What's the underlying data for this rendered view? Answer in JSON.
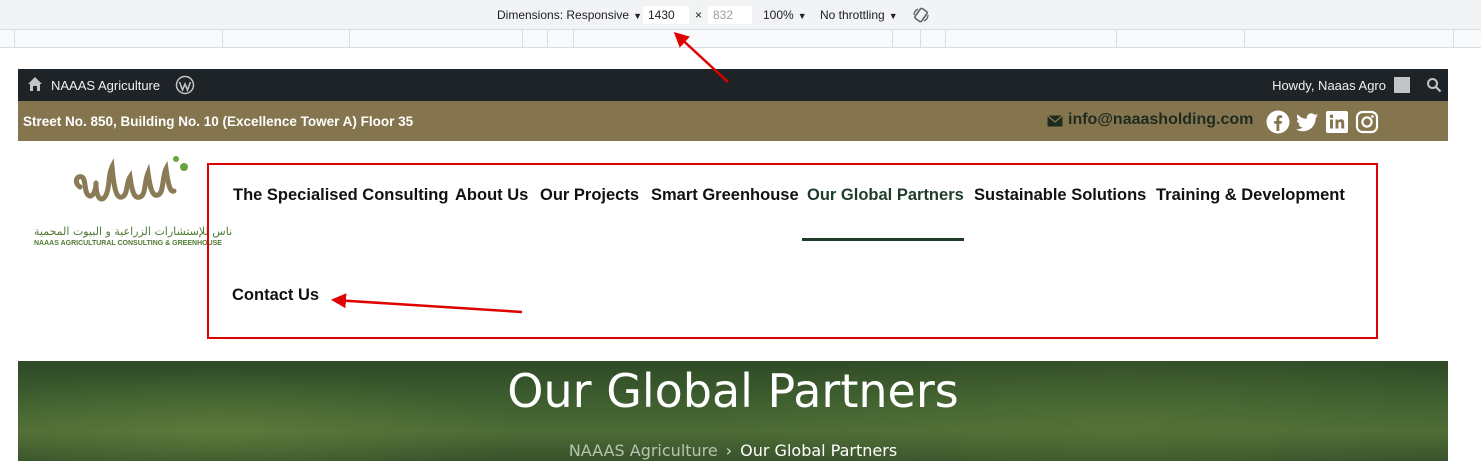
{
  "devtools": {
    "dimensions_label": "Dimensions: Responsive",
    "width_value": "1430",
    "times": "×",
    "height_value": "832",
    "zoom": "100%",
    "throttling": "No throttling"
  },
  "admin_bar": {
    "site_name": "NAAAS Agriculture",
    "howdy": "Howdy, Naaas Agro"
  },
  "info_bar": {
    "address": "Street No. 850, Building No. 10 (Excellence Tower A) Floor 35",
    "email": "info@naaasholding.com",
    "social_icons": [
      "facebook-icon",
      "twitter-icon",
      "linkedin-icon",
      "instagram-icon"
    ]
  },
  "logo": {
    "arabic": "ناس للإستشارات الزراعية و البيوت المحمية",
    "english": "NAAAS AGRICULTURAL CONSULTING & GREENHOUSE"
  },
  "nav": {
    "items": [
      {
        "label": "The Specialised Consulting"
      },
      {
        "label": "About Us"
      },
      {
        "label": "Our Projects"
      },
      {
        "label": "Smart Greenhouse"
      },
      {
        "label": "Our Global Partners",
        "active": true
      },
      {
        "label": "Sustainable Solutions"
      },
      {
        "label": "Training & Development"
      },
      {
        "label": "Contact Us"
      }
    ]
  },
  "hero": {
    "title": "Our Global Partners",
    "breadcrumb_home": "NAAAS Agriculture",
    "breadcrumb_sep": "›",
    "breadcrumb_current": "Our Global Partners"
  },
  "colors": {
    "admin_bar": "#1d2327",
    "info_bar": "#85754e",
    "active_nav": "#1f3d2a",
    "annotation": "#e00000"
  }
}
